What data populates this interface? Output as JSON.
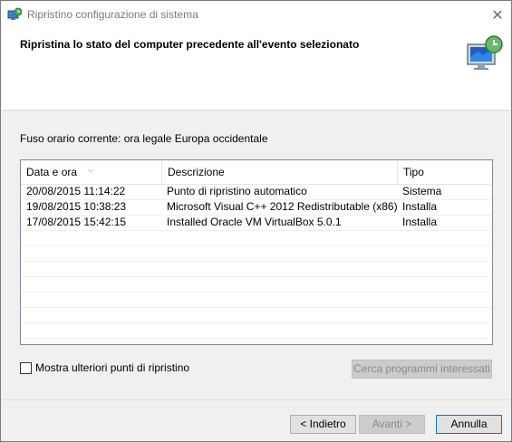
{
  "window": {
    "title": "Ripristino configurazione di sistema",
    "close_glyph": "✕"
  },
  "header": {
    "title": "Ripristina lo stato del computer precedente all'evento selezionato",
    "icon": "system-restore-monitor-icon"
  },
  "timezone_text": "Fuso orario corrente: ora legale Europa occidentale",
  "table": {
    "columns": [
      "Data e ora",
      "Descrizione",
      "Tipo"
    ],
    "sorted_column": "Data e ora",
    "rows": [
      {
        "date": "20/08/2015 11:14:22",
        "description": "Punto di ripristino automatico",
        "type": "Sistema"
      },
      {
        "date": "19/08/2015 10:38:23",
        "description": "Microsoft Visual C++ 2012 Redistributable (x86) ...",
        "type": "Installa"
      },
      {
        "date": "17/08/2015 15:42:15",
        "description": "Installed Oracle VM VirtualBox 5.0.1",
        "type": "Installa"
      }
    ]
  },
  "more_points_label": "Mostra ulteriori punti di ripristino",
  "scan_button_label": "Cerca programmi interessati",
  "buttons": {
    "back": "< Indietro",
    "next": "Avanti >",
    "cancel": "Annulla"
  },
  "colors": {
    "accent": "#0078d7",
    "window_bg": "#f0f0f0",
    "header_bg": "#ffffff"
  }
}
